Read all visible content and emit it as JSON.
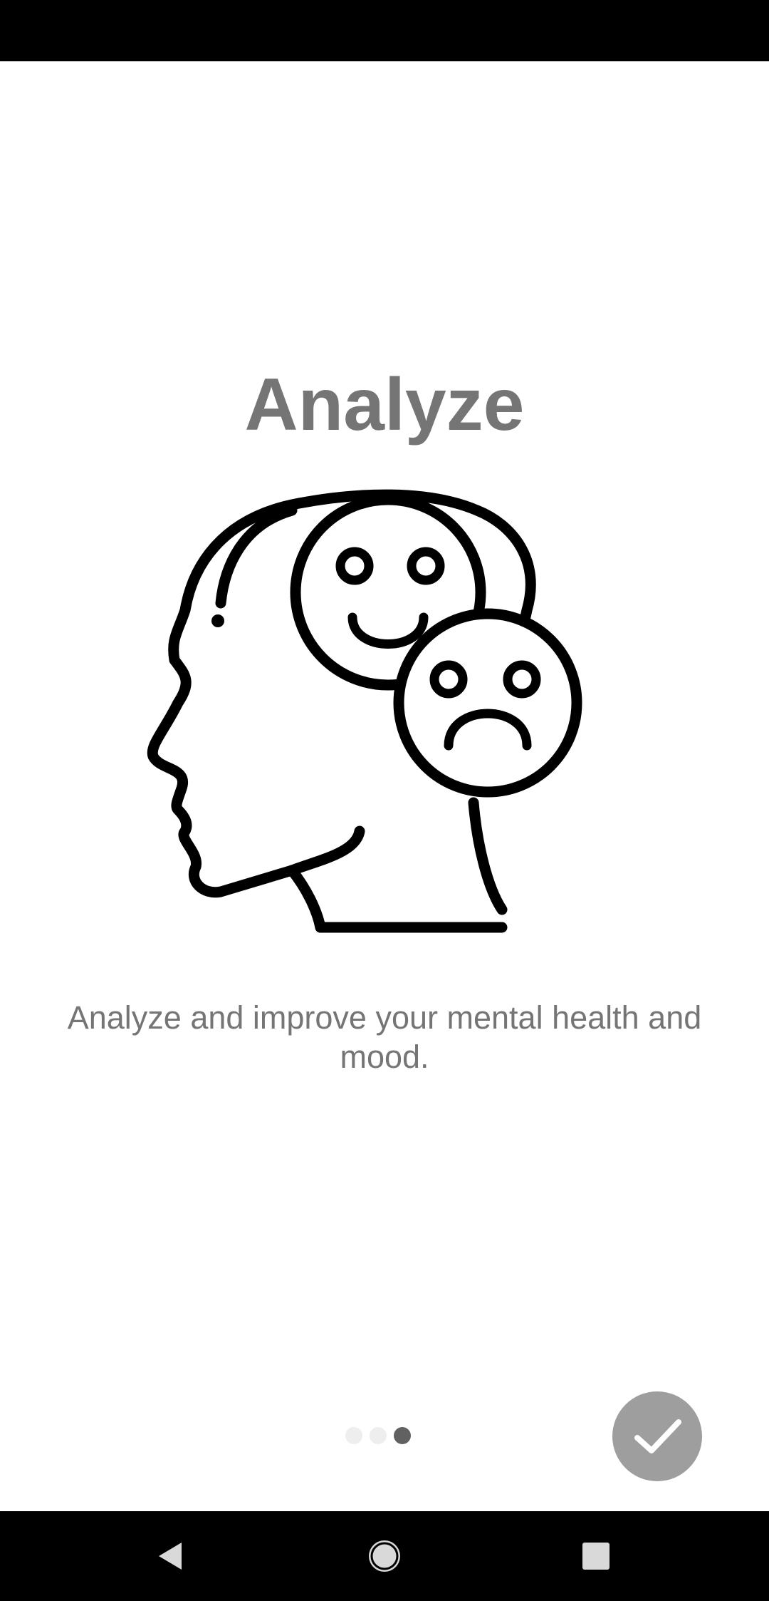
{
  "onboarding": {
    "title": "Analyze",
    "description": "Analyze and improve your mental health and mood.",
    "illustration_icon": "head-with-happy-and-sad-faces-icon",
    "page_indicator": {
      "total": 3,
      "current": 3
    },
    "done_icon": "checkmark-icon"
  },
  "colors": {
    "status_bar": "#000000",
    "background": "#ffffff",
    "text": "#757575",
    "dot_inactive": "#eeeeee",
    "dot_active": "#616161",
    "done_button": "#9e9e9e",
    "nav_bar": "#000000"
  },
  "navigation": {
    "back_icon": "back-triangle-icon",
    "home_icon": "home-circle-icon",
    "recents_icon": "recents-square-icon"
  }
}
